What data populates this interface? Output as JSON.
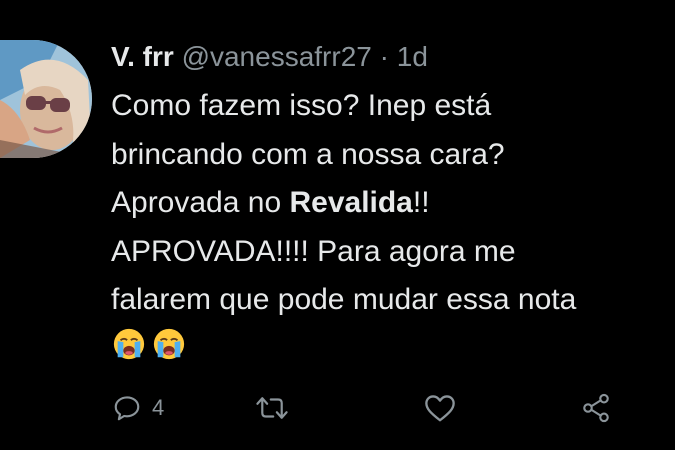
{
  "tweet": {
    "display_name": "V. frr",
    "handle": "@vanessafrr27",
    "separator": "·",
    "time": "1d",
    "lines": {
      "l1": "Como fazem isso? Inep está",
      "l2": "brincando com a nossa cara?",
      "l3_pre": "Aprovada no ",
      "l3_bold": "Revalida",
      "l3_post": "!!",
      "l4": "APROVADA!!!! Para agora me",
      "l5": "falarem que pode mudar essa nota"
    },
    "emojis": [
      "loudly-crying-face",
      "loudly-crying-face"
    ],
    "reply_count": "4"
  },
  "icons": {
    "reply": "reply-icon",
    "retweet": "retweet-icon",
    "like": "like-icon",
    "share": "share-icon"
  },
  "colors": {
    "background": "#000000",
    "text": "#e7e9ea",
    "secondary": "#8b949a"
  }
}
